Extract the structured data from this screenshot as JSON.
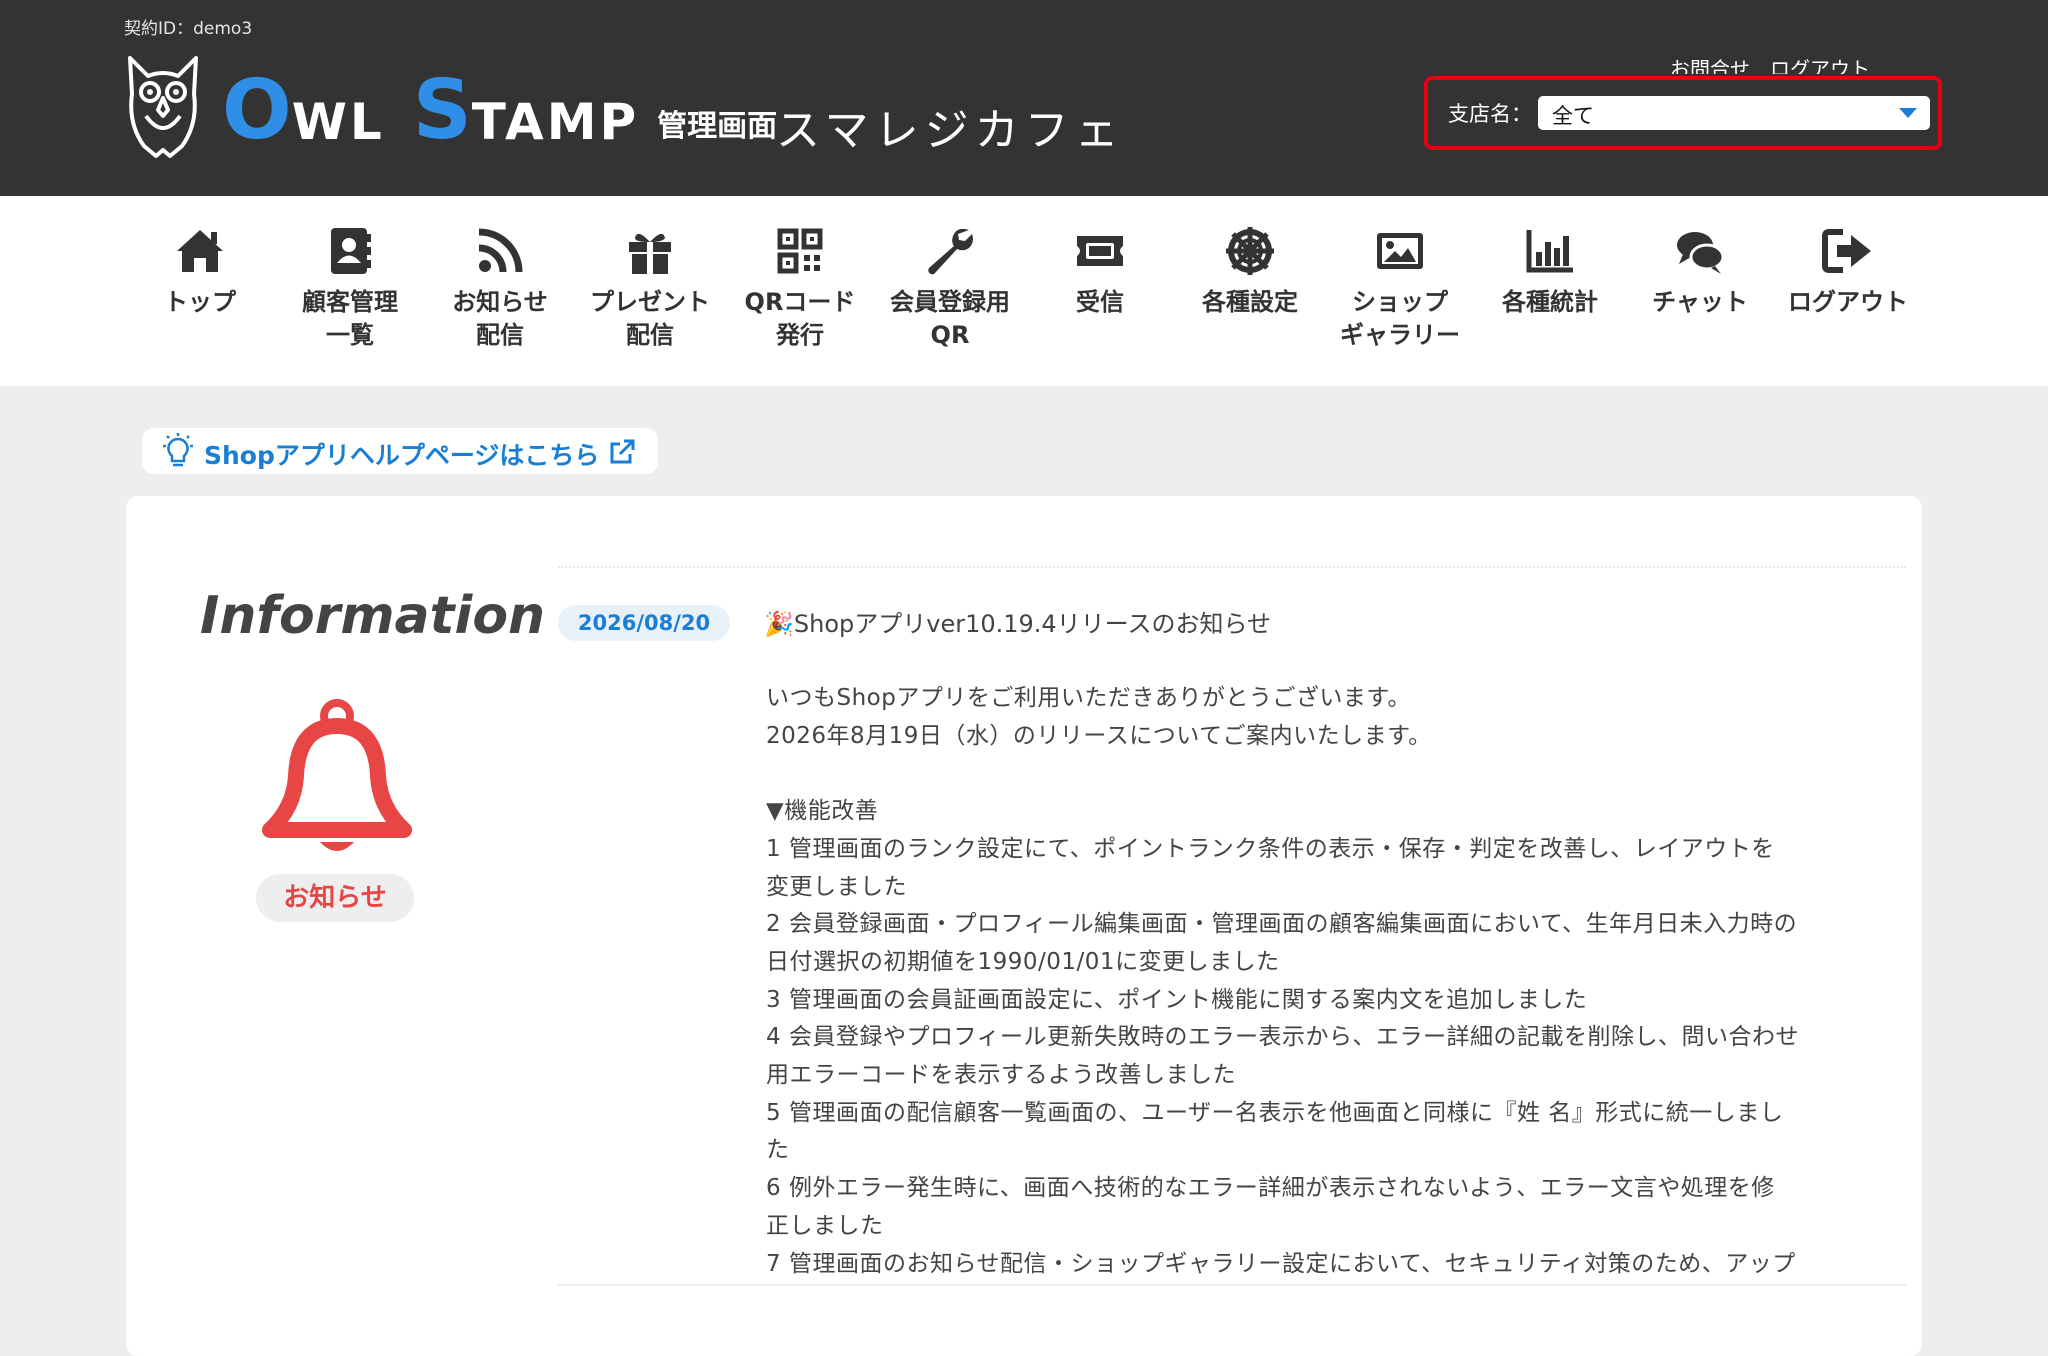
{
  "header": {
    "contract_id": "契約ID：demo3",
    "logo_cap1": "O",
    "logo_rest1": "WL",
    "logo_cap2": "S",
    "logo_rest2": "TAMP",
    "logo_sub": "管理画面",
    "shop_name": "スマレジカフェ",
    "links": "お問合せ　ログアウト",
    "branch_label": "支店名：",
    "branch_value": "全て"
  },
  "colors": {
    "header_bg": "#333333",
    "accent_blue": "#2f8fe8",
    "alert_red": "#e84545",
    "highlight_border": "#e60012"
  },
  "nav": [
    {
      "label": "トップ",
      "icon": "home-icon"
    },
    {
      "label": "顧客管理\n一覧",
      "icon": "contacts-icon"
    },
    {
      "label": "お知らせ\n配信",
      "icon": "rss-icon"
    },
    {
      "label": "プレゼント\n配信",
      "icon": "gift-icon"
    },
    {
      "label": "QRコード\n発行",
      "icon": "qrcode-icon"
    },
    {
      "label": "会員登録用\nQR",
      "icon": "wrench-icon"
    },
    {
      "label": "受信",
      "icon": "ticket-icon"
    },
    {
      "label": "各種設定",
      "icon": "settings-wheel-icon"
    },
    {
      "label": "ショップ\nギャラリー",
      "icon": "image-icon"
    },
    {
      "label": "各種統計",
      "icon": "bar-chart-icon"
    },
    {
      "label": "チャット",
      "icon": "chat-icon"
    },
    {
      "label": "ログアウト",
      "icon": "logout-icon"
    }
  ],
  "help": {
    "label": "Shopアプリヘルプページはこちら"
  },
  "info": {
    "title": "Information",
    "badge": "お知らせ",
    "date": "2026/08/20",
    "news_title": "🎉Shopアプリver10.19.4リリースのお知らせ",
    "body": [
      "いつもShopアプリをご利用いただきありがとうございます。",
      "2026年8月19日（水）のリリースについてご案内いたします。",
      "",
      "▼機能改善",
      "1 管理画面のランク設定にて、ポイントランク条件の表示・保存・判定を改善し、レイアウトを",
      "変更しました",
      "2 会員登録画面・プロフィール編集画面・管理画面の顧客編集画面において、生年月日未入力時の",
      "日付選択の初期値を1990/01/01に変更しました",
      "3 管理画面の会員証画面設定に、ポイント機能に関する案内文を追加しました",
      "4 会員登録やプロフィール更新失敗時のエラー表示から、エラー詳細の記載を削除し、問い合わせ",
      "用エラーコードを表示するよう改善しました",
      "5 管理画面の配信顧客一覧画面の、ユーザー名表示を他画面と同様に『姓 名』形式に統一しまし",
      "た",
      "6 例外エラー発生時に、画面へ技術的なエラー詳細が表示されないよう、エラー文言や処理を修",
      "正しました",
      "7 管理画面のお知らせ配信・ショップギャラリー設定において、セキュリティ対策のため、アップ"
    ]
  }
}
